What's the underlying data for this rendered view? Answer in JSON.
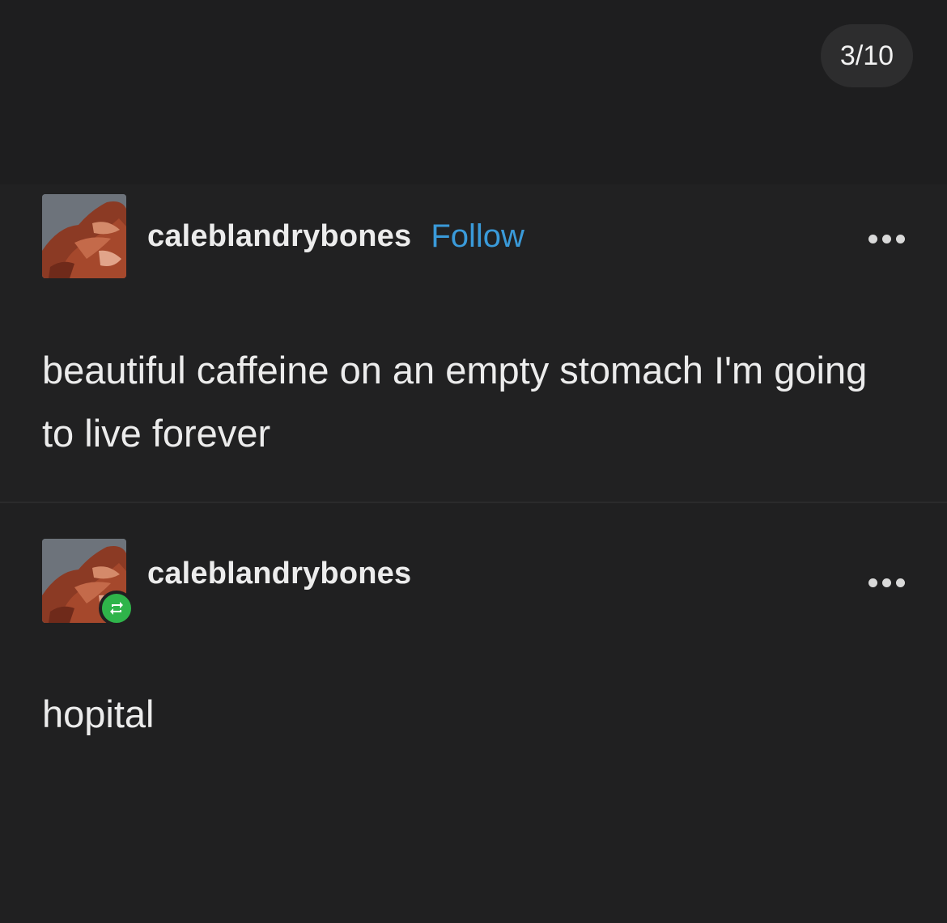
{
  "counter": {
    "text": "3/10"
  },
  "original_post": {
    "username": "caleblandrybones",
    "follow_label": "Follow",
    "text": "beautiful caffeine on an empty stomach I'm going to live forever"
  },
  "reblog_post": {
    "username": "caleblandrybones",
    "text": "hopital"
  },
  "icons": {
    "more": "more-options-icon",
    "reblog": "reblog-icon"
  },
  "colors": {
    "background": "#1e1e1f",
    "accent_follow": "#3a9ad9",
    "reblog_badge": "#2fb44a"
  }
}
